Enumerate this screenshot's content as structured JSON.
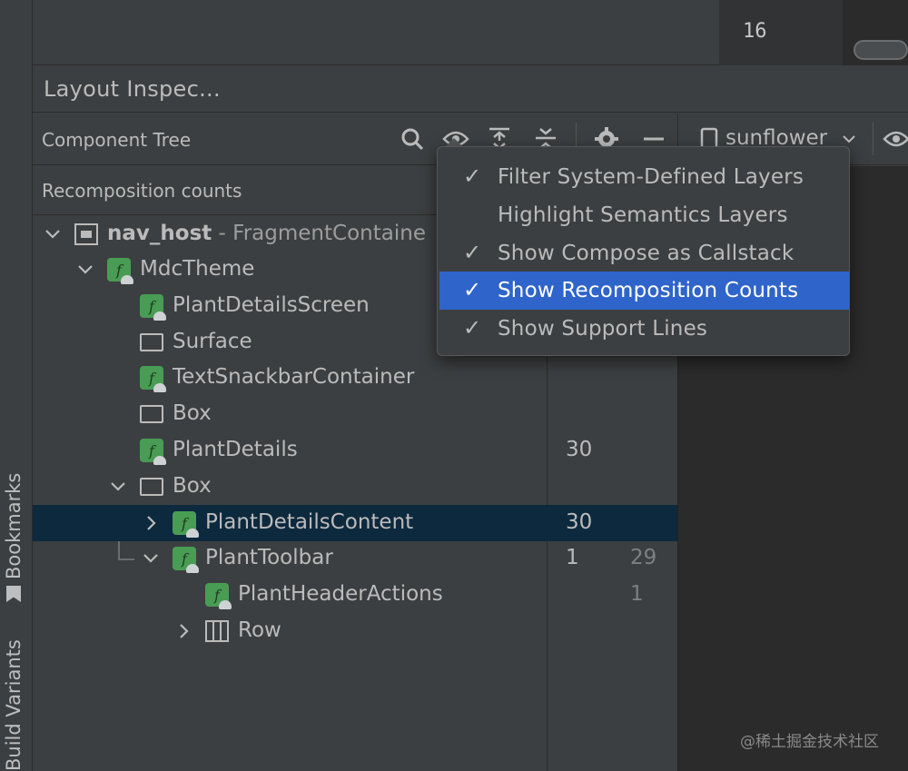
{
  "left_strip": {
    "bookmarks": "Bookmarks",
    "build_variants": "Build Variants"
  },
  "editor": {
    "line_number": "16"
  },
  "inspector": {
    "title": "Layout Inspec..."
  },
  "component_tree": {
    "title": "Component Tree",
    "toolbar_icons": [
      "search-icon",
      "eye-icon",
      "expand-all-icon",
      "collapse-all-icon",
      "gear-icon",
      "minimize-icon"
    ]
  },
  "device_selector": {
    "label": "sunflower"
  },
  "recomposition": {
    "header": "Recomposition counts"
  },
  "tree": [
    {
      "name": "nav_host",
      "suffix": " - FragmentContaine",
      "icon": "fragment-icon",
      "expand": "expanded",
      "count": "",
      "skip": ""
    },
    {
      "name": "MdcTheme",
      "suffix": "",
      "icon": "composable-icon",
      "expand": "expanded",
      "count": "",
      "skip": ""
    },
    {
      "name": "PlantDetailsScreen",
      "suffix": "",
      "icon": "composable-icon",
      "expand": "none",
      "count": "",
      "skip": ""
    },
    {
      "name": "Surface",
      "suffix": "",
      "icon": "layout-icon",
      "expand": "none",
      "count": "",
      "skip": ""
    },
    {
      "name": "TextSnackbarContainer",
      "suffix": "",
      "icon": "composable-icon",
      "expand": "none",
      "count": "",
      "skip": ""
    },
    {
      "name": "Box",
      "suffix": "",
      "icon": "layout-icon",
      "expand": "none",
      "count": "",
      "skip": ""
    },
    {
      "name": "PlantDetails",
      "suffix": "",
      "icon": "composable-icon",
      "expand": "none",
      "count": "30",
      "skip": ""
    },
    {
      "name": "Box",
      "suffix": "",
      "icon": "layout-icon",
      "expand": "expanded",
      "count": "",
      "skip": ""
    },
    {
      "name": "PlantDetailsContent",
      "suffix": "",
      "icon": "composable-icon",
      "expand": "collapsed",
      "count": "30",
      "skip": ""
    },
    {
      "name": "PlantToolbar",
      "suffix": "",
      "icon": "composable-icon",
      "expand": "expanded",
      "count": "1",
      "skip": "29"
    },
    {
      "name": "PlantHeaderActions",
      "suffix": "",
      "icon": "composable-icon",
      "expand": "none",
      "count": "",
      "skip": "1"
    },
    {
      "name": "Row",
      "suffix": "",
      "icon": "row-icon",
      "expand": "collapsed",
      "count": "",
      "skip": ""
    }
  ],
  "menu": {
    "items": [
      {
        "label": "Filter System-Defined Layers",
        "checked": "✓"
      },
      {
        "label": "Highlight Semantics Layers",
        "checked": ""
      },
      {
        "label": "Show Compose as Callstack",
        "checked": "✓"
      },
      {
        "label": "Show Recomposition Counts",
        "checked": "✓"
      },
      {
        "label": "Show Support Lines",
        "checked": "✓"
      }
    ]
  },
  "watermark": "@稀土掘金技术社区",
  "colors": {
    "background": "#3c3f41",
    "selection_row": "#0d293e",
    "menu_highlight": "#2f65ca",
    "composable_icon": "#499c54"
  }
}
